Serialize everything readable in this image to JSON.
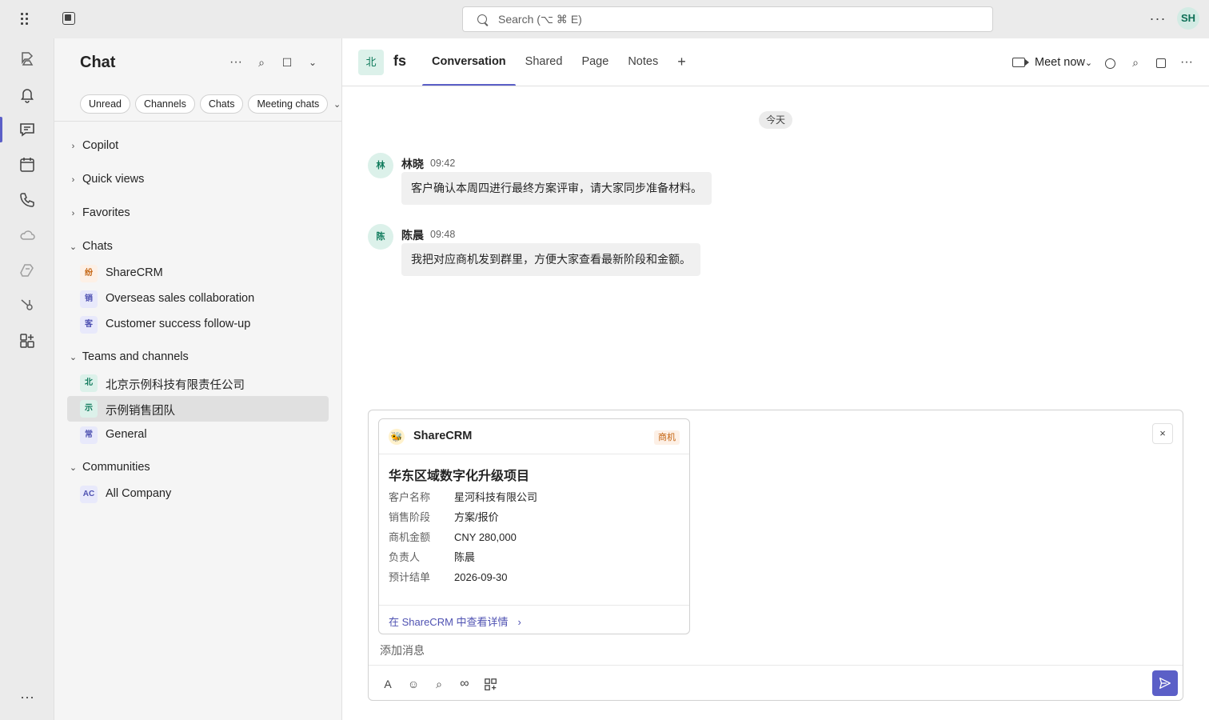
{
  "topbar": {
    "search_placeholder": "Search (⌥ ⌘ E)",
    "avatar_initials": "SH",
    "more": "···"
  },
  "listpane": {
    "title": "Chat",
    "icons": {
      "more": "···",
      "search": "⌕",
      "expand": "☐",
      "chevron": "⌄"
    },
    "filters": [
      "Unread",
      "Channels",
      "Chats",
      "Meeting chats"
    ],
    "filter_more": "⌄",
    "sections": {
      "copilot": {
        "chev": "›",
        "label": "Copilot"
      },
      "quick_views": {
        "chev": "›",
        "label": "Quick views"
      },
      "favorites": {
        "chev": "›",
        "label": "Favorites"
      },
      "chats": {
        "chev": "⌄",
        "label": "Chats"
      },
      "teams": {
        "chev": "⌄",
        "label": "Teams and channels"
      },
      "communities": {
        "chev": "⌄",
        "label": "Communities"
      }
    },
    "chats": [
      {
        "avatar": "纷",
        "name": "ShareCRM"
      },
      {
        "avatar": "销",
        "name": "Overseas sales collaboration"
      },
      {
        "avatar": "客",
        "name": "Customer success follow-up"
      }
    ],
    "teams": [
      {
        "avatar": "北",
        "name": "北京示例科技有限责任公司"
      },
      {
        "avatar": "示",
        "name": "示例销售团队"
      },
      {
        "avatar": "常",
        "name": "General"
      }
    ],
    "communities": [
      {
        "avatar": "AC",
        "name": "All Company"
      }
    ]
  },
  "main": {
    "avatar": "北",
    "title": "fs",
    "tabs": [
      "Conversation",
      "Shared",
      "Page",
      "Notes",
      "+"
    ],
    "meet_label": "Meet now",
    "meet_chevron": "⌄",
    "icons": {
      "search": "⌕",
      "more": "···"
    },
    "date_label": "今天",
    "messages": [
      {
        "avatar": "林",
        "sender": "林晓",
        "time": "09:42",
        "text": "客户确认本周四进行最终方案评审，请大家同步准备材料。"
      },
      {
        "avatar": "陈",
        "sender": "陈晨",
        "time": "09:48",
        "text": "我把对应商机发到群里，方便大家查看最新阶段和金额。"
      }
    ]
  },
  "card": {
    "logo": "🐝",
    "app": "ShareCRM",
    "badge": "商机",
    "title": "华东区域数字化升级项目",
    "fields": [
      {
        "label": "客户名称",
        "value": "星河科技有限公司"
      },
      {
        "label": "销售阶段",
        "value": "方案/报价"
      },
      {
        "label": "商机金额",
        "value": "CNY 280,000"
      },
      {
        "label": "负责人",
        "value": "陈晨"
      },
      {
        "label": "预计结单",
        "value": "2026-09-30"
      }
    ],
    "link": "在 ShareCRM 中查看详情",
    "link_arrow": "›"
  },
  "compose": {
    "close": "×",
    "placeholder": "添加消息",
    "tools": {
      "format": "A",
      "emoji": "☺",
      "search": "⌕",
      "loop": "∞"
    }
  },
  "colors": {
    "accent": "#5b5fc7",
    "rail_bg": "#ebebeb",
    "badge": "#c4630f"
  }
}
